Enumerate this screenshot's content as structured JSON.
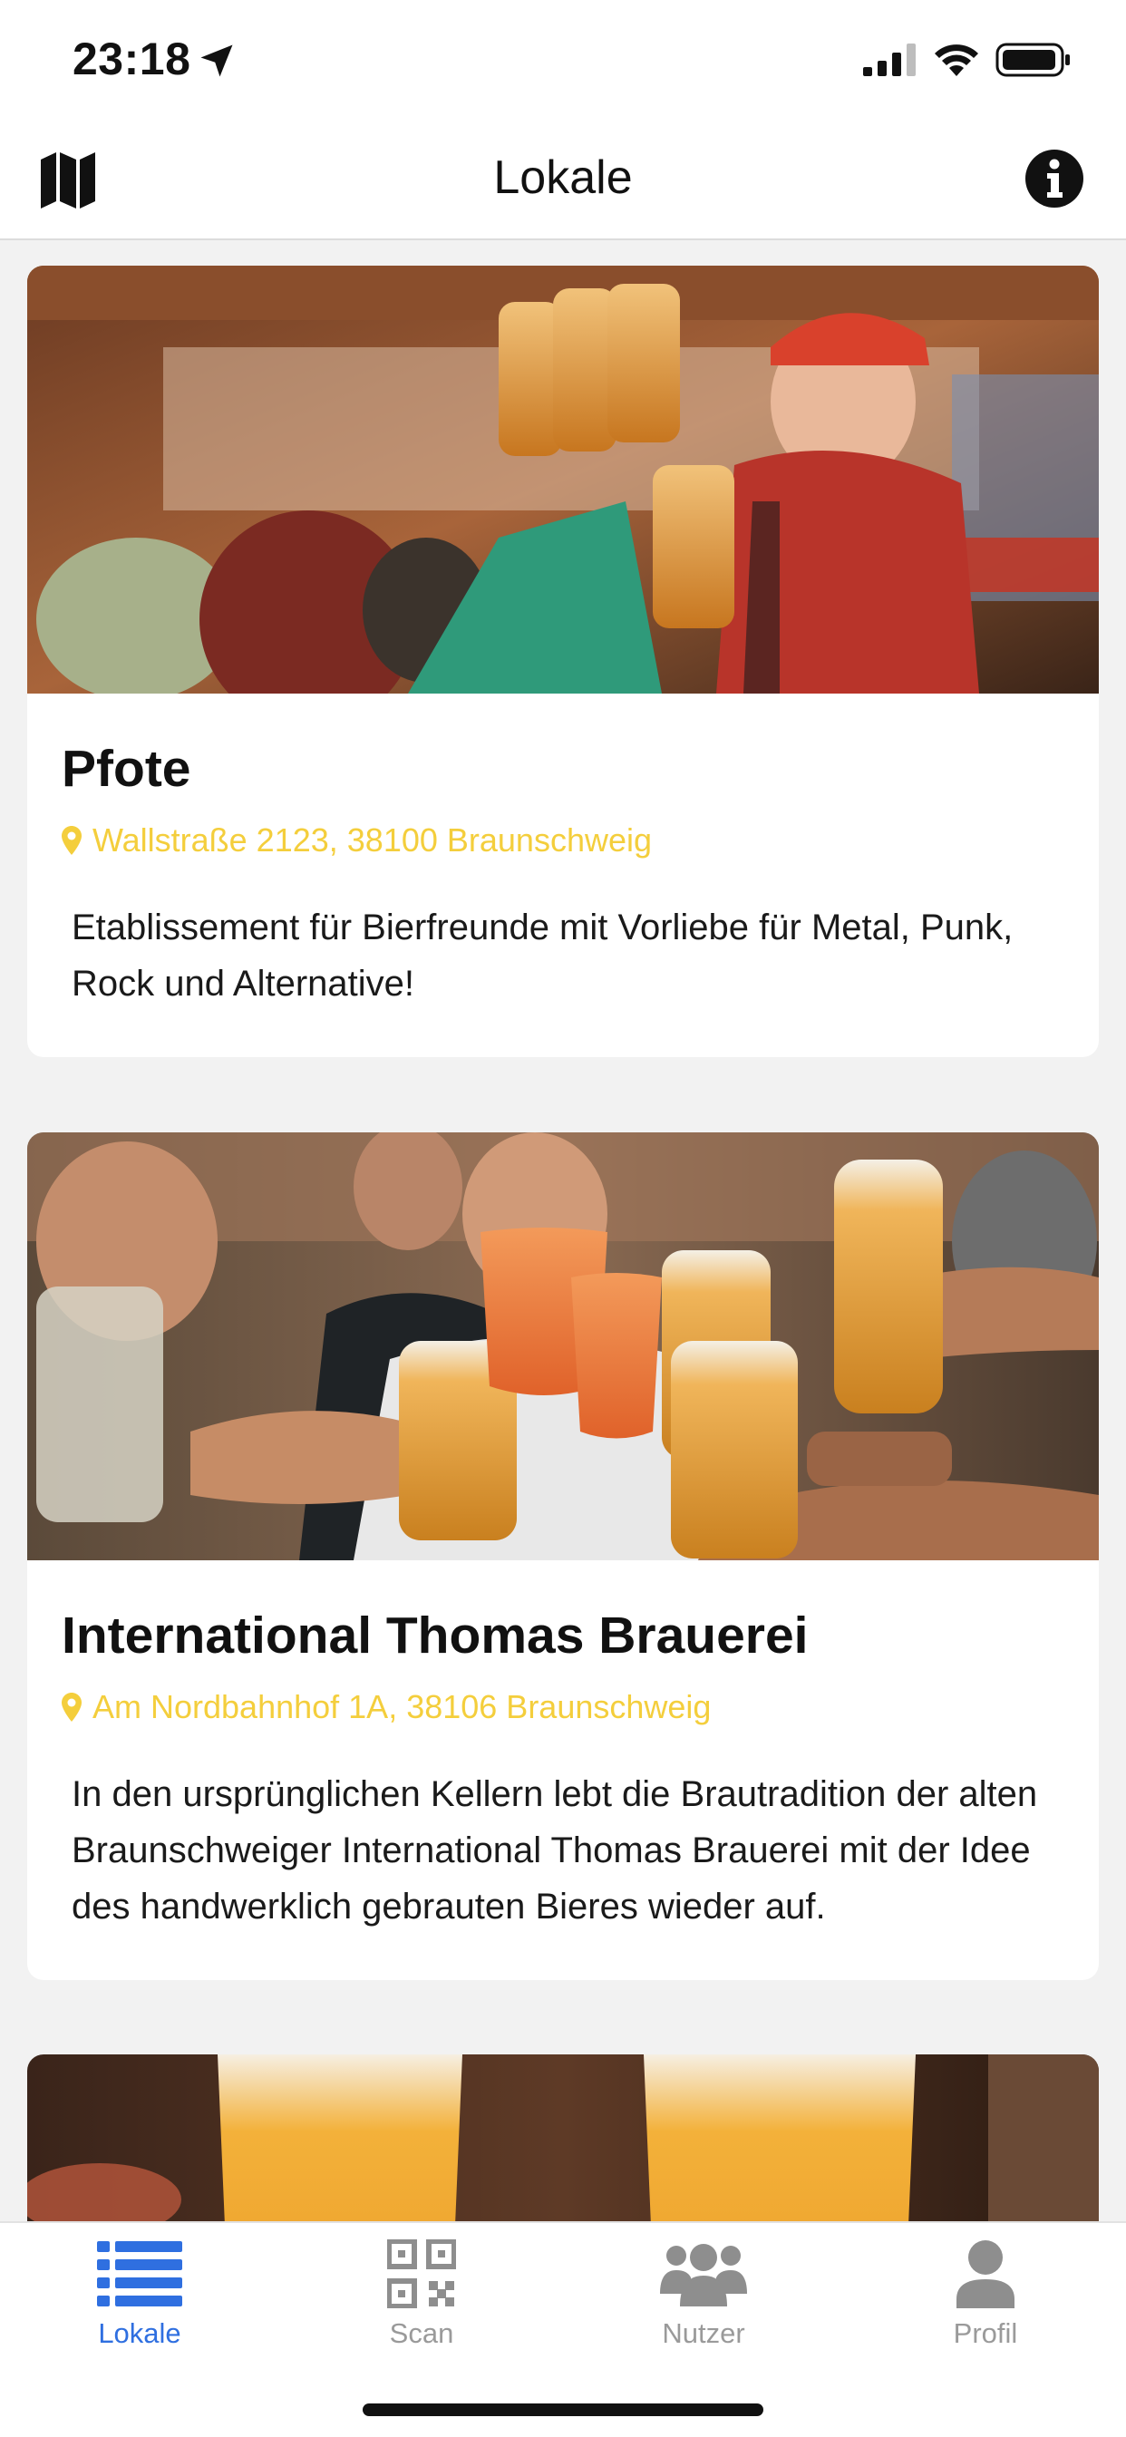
{
  "status_bar": {
    "time": "23:18"
  },
  "nav": {
    "title": "Lokale"
  },
  "venues": [
    {
      "name": "Pfote",
      "address": "Wallstraße 2123, 38100 Braunschweig",
      "description": "Etablissement für Bierfreunde mit Vorliebe für Metal, Punk, Rock und Alternative!"
    },
    {
      "name": "International Thomas Brauerei",
      "address": "Am Nordbahnhof 1A, 38106 Braunschweig",
      "description": "In den ursprünglichen Kellern lebt die Brautradition der alten Braunschweiger International Thomas Brauerei mit der Idee des handwerklich gebrauten Bieres wieder auf."
    }
  ],
  "tabs": [
    {
      "label": "Lokale",
      "icon": "list-icon",
      "active": true
    },
    {
      "label": "Scan",
      "icon": "qr-code-icon",
      "active": false
    },
    {
      "label": "Nutzer",
      "icon": "users-icon",
      "active": false
    },
    {
      "label": "Profil",
      "icon": "user-icon",
      "active": false
    }
  ],
  "colors": {
    "accent": "#2f6fe0",
    "address": "#f4ce3c",
    "inactive_tab": "#9a9a9a",
    "background": "#f2f2f2"
  }
}
